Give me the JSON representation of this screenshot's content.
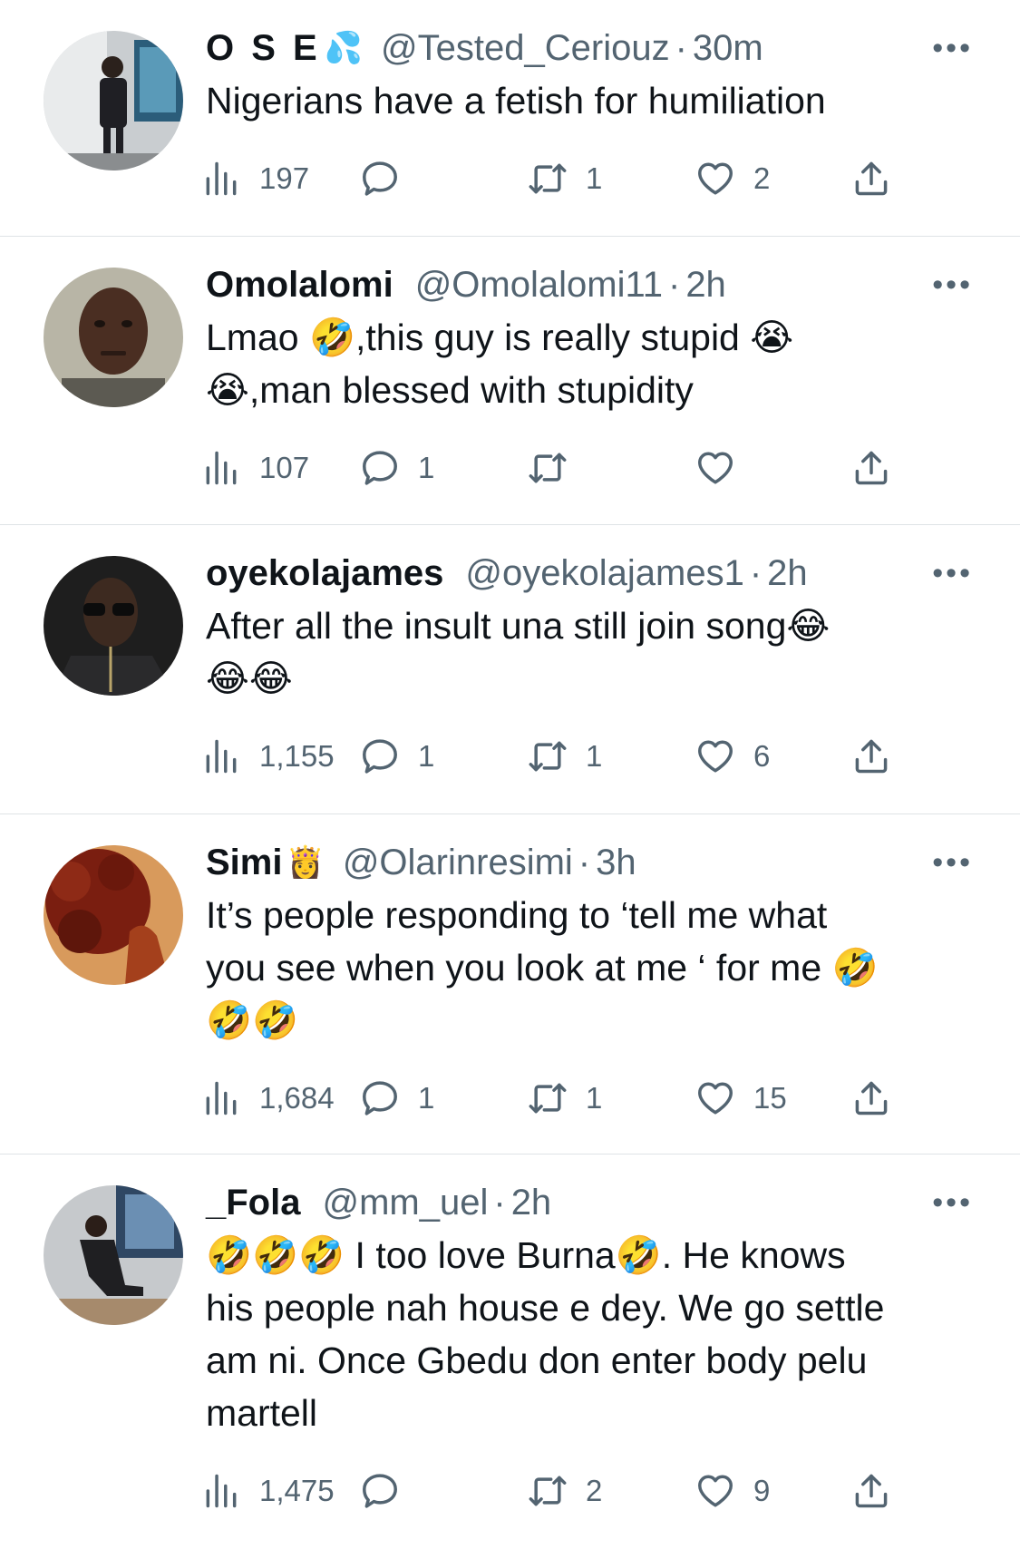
{
  "tweets": [
    {
      "name": "O S E",
      "badge": "💦",
      "handle": "@Tested_Ceriouz",
      "time": "30m",
      "text": "Nigerians have a fetish for humiliation",
      "views": "197",
      "replies": "",
      "retweets": "1",
      "likes": "2"
    },
    {
      "name": "Omolalomi",
      "badge": "",
      "handle": "@Omolalomi11",
      "time": "2h",
      "text": "Lmao 🤣,this guy is really stupid 😭\n😭,man blessed with stupidity",
      "views": "107",
      "replies": "1",
      "retweets": "",
      "likes": ""
    },
    {
      "name": "oyekolajames",
      "badge": "",
      "handle": "@oyekolajames1",
      "time": "2h",
      "text": "After all the insult una still join song😂\n😂😂",
      "views": "1,155",
      "replies": "1",
      "retweets": "1",
      "likes": "6"
    },
    {
      "name": "Simi",
      "badge": "👸",
      "handle": "@Olarinresimi",
      "time": "3h",
      "text": "It’s people responding to ‘tell me what\nyou see when you look at me ‘ for me 🤣\n🤣🤣",
      "views": "1,684",
      "replies": "1",
      "retweets": "1",
      "likes": "15"
    },
    {
      "name": "_Fola",
      "badge": "",
      "handle": "@mm_uel",
      "time": "2h",
      "text": "🤣🤣🤣 I too love Burna🤣. He knows\nhis people nah house e dey. We go settle\nam ni. Once Gbedu don enter body pelu\nmartell",
      "views": "1,475",
      "replies": "",
      "retweets": "2",
      "likes": "9"
    }
  ],
  "ui": {
    "more": "•••",
    "dot": "·"
  },
  "icons": {
    "views": "bar-chart-icon",
    "reply": "speech-bubble-icon",
    "retweet": "retweet-arrows-icon",
    "like": "heart-outline-icon",
    "share": "share-upload-icon",
    "more": "three-dots-icon"
  },
  "colors": {
    "text": "#0f1419",
    "secondary": "#536471",
    "divider": "#dfe3e6"
  }
}
